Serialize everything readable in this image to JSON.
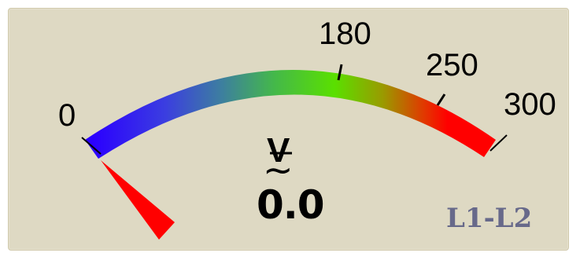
{
  "gauge": {
    "scale_labels": [
      "0",
      "180",
      "250",
      "300"
    ],
    "unit": "V",
    "ac_symbol": "~",
    "value": "0.0",
    "reading": 0,
    "range": [
      0,
      300
    ],
    "phase_label": "L1-L2",
    "colors": {
      "background": "#ded9c3",
      "low": "#2b00ff",
      "mid": "#5ae000",
      "high": "#ff0000",
      "needle": "#ff0000",
      "phase_label": "#67698a"
    }
  }
}
